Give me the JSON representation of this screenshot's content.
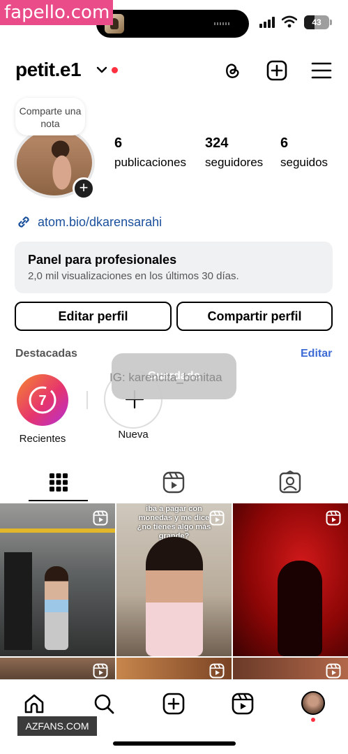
{
  "watermarks": {
    "top": "fapello.com",
    "bottom": "AZFANS.COM"
  },
  "status_bar": {
    "battery_percent": 43
  },
  "header": {
    "username": "petit.e1",
    "icons": [
      "threads-icon",
      "create-post-icon",
      "menu-icon"
    ]
  },
  "profile": {
    "note_bubble": "Comparte una nota",
    "stats": [
      {
        "value": "6",
        "label": "publicaciones"
      },
      {
        "value": "324",
        "label": "seguidores"
      },
      {
        "value": "6",
        "label": "seguidos"
      }
    ],
    "bio_link": "atom.bio/dkarensarahi"
  },
  "dashboard": {
    "title": "Panel para profesionales",
    "subtitle": "2,0 mil visualizaciones en los últimos 30 días."
  },
  "buttons": {
    "edit_profile": "Editar perfil",
    "share_profile": "Compartir perfil"
  },
  "highlights": {
    "title": "Destacadas",
    "edit": "Editar",
    "items": [
      {
        "label": "Recientes",
        "badge": "7"
      },
      {
        "label": "Nueva"
      }
    ]
  },
  "overlay": {
    "toast": "Guardado",
    "ig_text": "IG: karencita_bonitaa"
  },
  "tabs": [
    "grid-tab",
    "reels-tab",
    "tagged-tab"
  ],
  "grid": [
    {
      "kind": "reel",
      "caption": ""
    },
    {
      "kind": "reel",
      "caption": "iba a pagar con monedas y me dice ¿no tienes algo más grande?"
    },
    {
      "kind": "reel",
      "caption": ""
    },
    {
      "kind": "reel",
      "caption": ""
    },
    {
      "kind": "reel",
      "caption": ""
    },
    {
      "kind": "reel",
      "caption": ""
    }
  ],
  "bottom_nav": [
    "home-tab",
    "search-tab",
    "create-tab",
    "reels-tab",
    "profile-tab"
  ]
}
